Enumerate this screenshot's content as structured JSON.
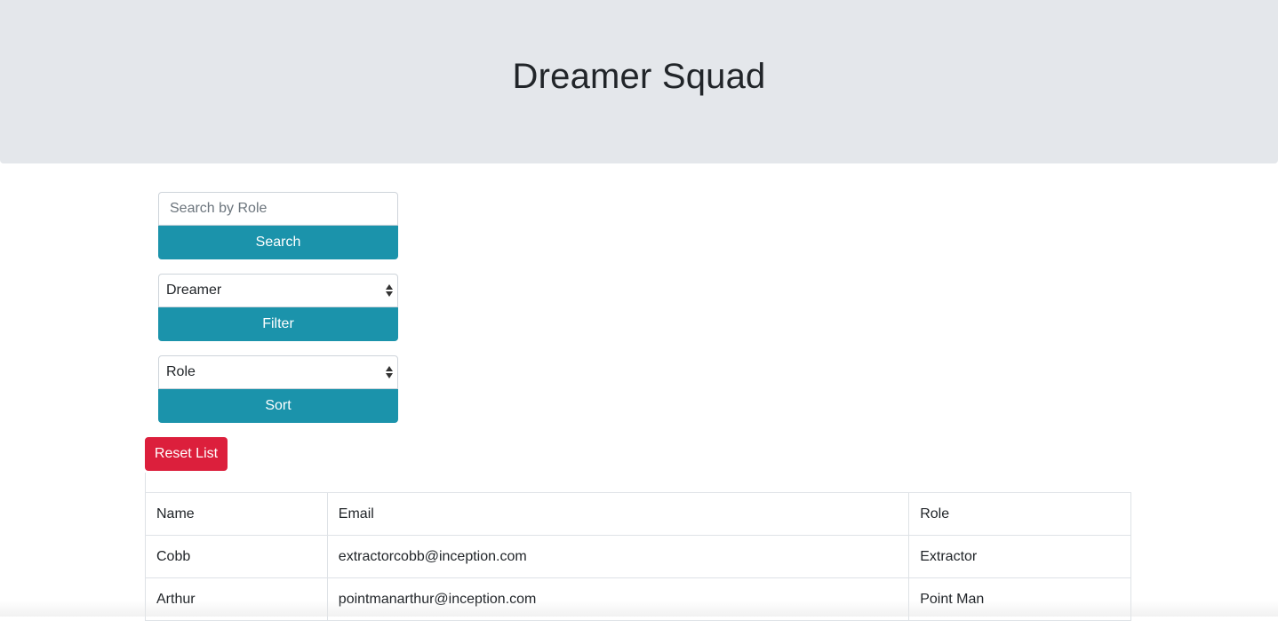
{
  "header": {
    "title": "Dreamer Squad"
  },
  "search": {
    "placeholder": "Search by Role",
    "button_label": "Search"
  },
  "filter": {
    "selected": "Dreamer",
    "button_label": "Filter"
  },
  "sort": {
    "selected": "Role",
    "button_label": "Sort"
  },
  "reset": {
    "button_label": "Reset List"
  },
  "table": {
    "headers": [
      "Name",
      "Email",
      "Role"
    ],
    "rows": [
      [
        "Cobb",
        "extractorcobb@inception.com",
        "Extractor"
      ],
      [
        "Arthur",
        "pointmanarthur@inception.com",
        "Point Man"
      ]
    ]
  },
  "colors": {
    "jumbotron_bg": "#e4e7eb",
    "primary_button": "#1b93ab",
    "danger_button": "#dc1f3c"
  },
  "icons": {
    "select_arrows": "updown-arrows-icon"
  }
}
